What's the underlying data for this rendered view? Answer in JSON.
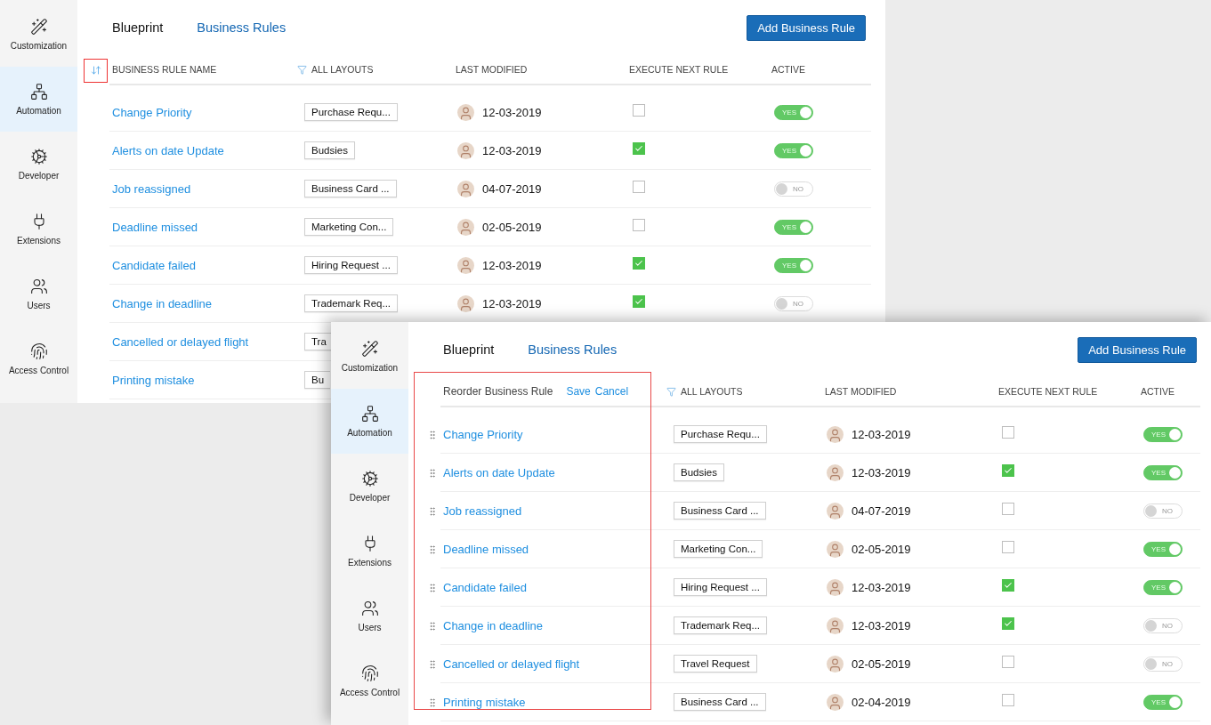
{
  "windows": [
    {
      "sidebar": {
        "items": [
          {
            "label": "Customization",
            "selected": false
          },
          {
            "label": "Automation",
            "selected": true
          },
          {
            "label": "Developer",
            "selected": false
          },
          {
            "label": "Extensions",
            "selected": false
          },
          {
            "label": "Users",
            "selected": false
          },
          {
            "label": "Access Control",
            "selected": false
          }
        ]
      },
      "tabs": [
        {
          "label": "Blueprint",
          "selected": false
        },
        {
          "label": "Business Rules",
          "selected": true
        }
      ],
      "add_button": "Add Business Rule",
      "name_column": {
        "kind": "label",
        "label": "BUSINESS RULE NAME",
        "highlighted": true
      },
      "columns": [
        {
          "label": "ALL LAYOUTS",
          "filter": true
        },
        {
          "label": "LAST MODIFIED",
          "filter": false
        },
        {
          "label": "EXECUTE NEXT RULE",
          "filter": false
        },
        {
          "label": "ACTIVE",
          "filter": false
        }
      ],
      "rows": [
        {
          "name": "Change Priority",
          "layout": "Purchase Requ...",
          "modified": "12-03-2019",
          "execute_next": false,
          "active": true,
          "active_label": "YES"
        },
        {
          "name": "Alerts on date Update",
          "layout": "Budsies",
          "modified": "12-03-2019",
          "execute_next": true,
          "active": true,
          "active_label": "YES"
        },
        {
          "name": "Job reassigned",
          "layout": "Business Card ...",
          "modified": "04-07-2019",
          "execute_next": false,
          "active": false,
          "active_label": "NO"
        },
        {
          "name": "Deadline missed",
          "layout": "Marketing Con...",
          "modified": "02-05-2019",
          "execute_next": false,
          "active": true,
          "active_label": "YES"
        },
        {
          "name": "Candidate failed",
          "layout": "Hiring Request ...",
          "modified": "12-03-2019",
          "execute_next": true,
          "active": true,
          "active_label": "YES"
        },
        {
          "name": "Change in deadline",
          "layout": "Trademark Req...",
          "modified": "12-03-2019",
          "execute_next": true,
          "active": false,
          "active_label": "NO"
        },
        {
          "name": "Cancelled or delayed flight",
          "layout": "Tra",
          "layout_cut": true
        },
        {
          "name": "Printing mistake",
          "layout": "Bu",
          "layout_cut": true
        }
      ]
    },
    {
      "sidebar": {
        "items": [
          {
            "label": "Customization",
            "selected": false
          },
          {
            "label": "Automation",
            "selected": true
          },
          {
            "label": "Developer",
            "selected": false
          },
          {
            "label": "Extensions",
            "selected": false
          },
          {
            "label": "Users",
            "selected": false
          },
          {
            "label": "Access Control",
            "selected": false
          }
        ]
      },
      "tabs": [
        {
          "label": "Blueprint",
          "selected": false
        },
        {
          "label": "Business Rules",
          "selected": true
        }
      ],
      "add_button": "Add Business Rule",
      "name_column": {
        "kind": "reorder",
        "title": "Reorder Business Rule",
        "save": "Save",
        "cancel": "Cancel",
        "highlighted": true
      },
      "columns": [
        {
          "label": "ALL LAYOUTS",
          "filter": true
        },
        {
          "label": "LAST MODIFIED",
          "filter": false
        },
        {
          "label": "EXECUTE NEXT RULE",
          "filter": false
        },
        {
          "label": "ACTIVE",
          "filter": false
        }
      ],
      "rows": [
        {
          "name": "Change Priority",
          "layout": "Purchase Requ...",
          "modified": "12-03-2019",
          "execute_next": false,
          "active": true,
          "active_label": "YES"
        },
        {
          "name": "Alerts on date Update",
          "layout": "Budsies",
          "modified": "12-03-2019",
          "execute_next": true,
          "active": true,
          "active_label": "YES"
        },
        {
          "name": "Job reassigned",
          "layout": "Business Card ...",
          "modified": "04-07-2019",
          "execute_next": false,
          "active": false,
          "active_label": "NO"
        },
        {
          "name": "Deadline missed",
          "layout": "Marketing Con...",
          "modified": "02-05-2019",
          "execute_next": false,
          "active": true,
          "active_label": "YES"
        },
        {
          "name": "Candidate failed",
          "layout": "Hiring Request ...",
          "modified": "12-03-2019",
          "execute_next": true,
          "active": true,
          "active_label": "YES"
        },
        {
          "name": "Change in deadline",
          "layout": "Trademark Req...",
          "modified": "12-03-2019",
          "execute_next": true,
          "active": false,
          "active_label": "NO"
        },
        {
          "name": "Cancelled or delayed flight",
          "layout": "Travel Request",
          "modified": "02-05-2019",
          "execute_next": false,
          "active": false,
          "active_label": "NO"
        },
        {
          "name": "Printing mistake",
          "layout": "Business Card ...",
          "modified": "02-04-2019",
          "execute_next": false,
          "active": true,
          "active_label": "YES"
        }
      ]
    }
  ]
}
